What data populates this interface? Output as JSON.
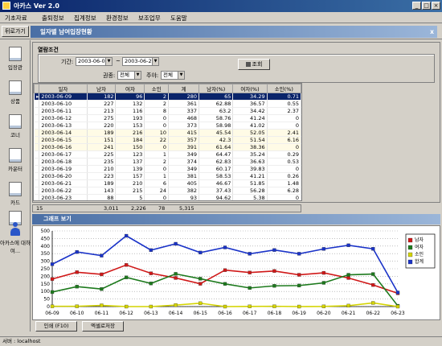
{
  "window": {
    "title": "아카스 Ver 2.0"
  },
  "menu": [
    "기초자료",
    "출퇴정보",
    "집계정보",
    "환경정보",
    "보조업무",
    "도움말"
  ],
  "toolbar": {
    "back_label": "뒤로가기",
    "form_title": "일자별 남여입장현황",
    "close_glyph": "x"
  },
  "sidebar": [
    {
      "label": "입장관",
      "icon": "document-icon"
    },
    {
      "label": "상품",
      "icon": "document-icon"
    },
    {
      "label": "코너",
      "icon": "document-icon"
    },
    {
      "label": "카운터",
      "icon": "document-icon"
    },
    {
      "label": "카드",
      "icon": "document-icon"
    },
    {
      "label": "계정",
      "icon": "document-icon"
    },
    {
      "label": "아카스에 대하여...",
      "icon": "person-icon"
    }
  ],
  "conditions": {
    "section_label": "열람조건",
    "period_label": "기간:",
    "date_from": "2003-06-02",
    "date_to": "2003-06-25",
    "separator": "~",
    "type_label": "권종:",
    "type_value": "전체",
    "week_label": "주야:",
    "week_value": "전체",
    "query_button": "조회"
  },
  "table": {
    "columns": [
      "일자",
      "남자",
      "여자",
      "소인",
      "계",
      "남자(%)",
      "여자(%)",
      "소인(%)"
    ],
    "rows": [
      [
        "2003-06-09",
        "182",
        "96",
        "2",
        "280",
        "65",
        "34.29",
        "0.71"
      ],
      [
        "2003-06-10",
        "227",
        "132",
        "2",
        "361",
        "62.88",
        "36.57",
        "0.55"
      ],
      [
        "2003-06-11",
        "213",
        "116",
        "8",
        "337",
        "63.2",
        "34.42",
        "2.37"
      ],
      [
        "2003-06-12",
        "275",
        "193",
        "0",
        "468",
        "58.76",
        "41.24",
        "0"
      ],
      [
        "2003-06-13",
        "220",
        "153",
        "0",
        "373",
        "58.98",
        "41.02",
        "0"
      ],
      [
        "2003-06-14",
        "189",
        "216",
        "10",
        "415",
        "45.54",
        "52.05",
        "2.41"
      ],
      [
        "2003-06-15",
        "151",
        "184",
        "22",
        "357",
        "42.3",
        "51.54",
        "6.16"
      ],
      [
        "2003-06-16",
        "241",
        "150",
        "0",
        "391",
        "61.64",
        "38.36",
        "0"
      ],
      [
        "2003-06-17",
        "225",
        "123",
        "1",
        "349",
        "64.47",
        "35.24",
        "0.29"
      ],
      [
        "2003-06-18",
        "235",
        "137",
        "2",
        "374",
        "62.83",
        "36.63",
        "0.53"
      ],
      [
        "2003-06-19",
        "210",
        "139",
        "0",
        "349",
        "60.17",
        "39.83",
        "0"
      ],
      [
        "2003-06-20",
        "223",
        "157",
        "1",
        "381",
        "58.53",
        "41.21",
        "0.26"
      ],
      [
        "2003-06-21",
        "189",
        "210",
        "6",
        "405",
        "46.67",
        "51.85",
        "1.48"
      ],
      [
        "2003-06-22",
        "143",
        "215",
        "24",
        "382",
        "37.43",
        "56.28",
        "6.28"
      ],
      [
        "2003-06-23",
        "88",
        "5",
        "0",
        "93",
        "94.62",
        "5.38",
        "0"
      ]
    ]
  },
  "totals": {
    "count": "15",
    "male": "3,011",
    "female": "2,226",
    "child": "78",
    "sum": "5,315"
  },
  "graph": {
    "header": "그래프 보기"
  },
  "chart_data": {
    "type": "line",
    "categories": [
      "06-09",
      "06-10",
      "06-11",
      "06-12",
      "06-13",
      "06-14",
      "06-15",
      "06-16",
      "06-17",
      "06-18",
      "06-19",
      "06-20",
      "06-21",
      "06-22",
      "06-23"
    ],
    "ylim": [
      0,
      500
    ],
    "yticks": [
      0,
      50,
      100,
      150,
      200,
      250,
      300,
      350,
      400,
      450,
      500
    ],
    "grid": true,
    "legend_position": "right",
    "series": [
      {
        "name": "남자",
        "color": "#d01818",
        "values": [
          182,
          227,
          213,
          275,
          220,
          189,
          151,
          241,
          225,
          235,
          210,
          223,
          189,
          143,
          88
        ]
      },
      {
        "name": "여자",
        "color": "#1d7a1d",
        "values": [
          96,
          132,
          116,
          193,
          153,
          216,
          184,
          150,
          123,
          137,
          139,
          157,
          210,
          215,
          5
        ]
      },
      {
        "name": "소인",
        "color": "#d4d400",
        "values": [
          2,
          2,
          8,
          0,
          0,
          10,
          22,
          0,
          1,
          2,
          0,
          1,
          6,
          24,
          0
        ]
      },
      {
        "name": "합계",
        "color": "#1a33c8",
        "values": [
          280,
          361,
          337,
          468,
          373,
          415,
          357,
          391,
          349,
          374,
          349,
          381,
          405,
          382,
          93
        ]
      }
    ]
  },
  "footer": {
    "print_label": "인쇄 (F10)",
    "excel_label": "엑셀로저장"
  },
  "status": {
    "text": "서버 : localhost"
  }
}
